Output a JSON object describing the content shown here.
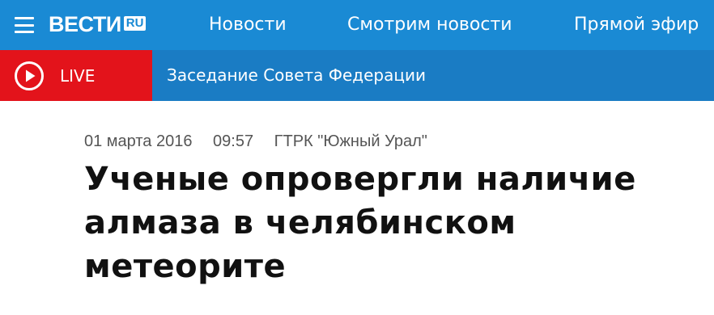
{
  "header": {
    "menu_icon": "hamburger-menu-icon",
    "logo": {
      "main": "ВЕСТИ",
      "suffix": "RU"
    },
    "nav": [
      {
        "label": "Новости"
      },
      {
        "label": "Смотрим новости"
      },
      {
        "label": "Прямой эфир"
      }
    ],
    "colors": {
      "background": "#1a8ad4"
    }
  },
  "live": {
    "icon": "play-circle-icon",
    "label": "LIVE",
    "title": "Заседание Совета Федерации",
    "colors": {
      "badge": "#e3131b",
      "bar": "#1a7cc4"
    }
  },
  "article": {
    "date": "01 марта 2016",
    "time": "09:57",
    "source": "ГТРК \"Южный Урал\"",
    "title_lines": [
      "Ученые опровергли наличие",
      "алмаза в челябинском",
      "метеорите"
    ]
  }
}
